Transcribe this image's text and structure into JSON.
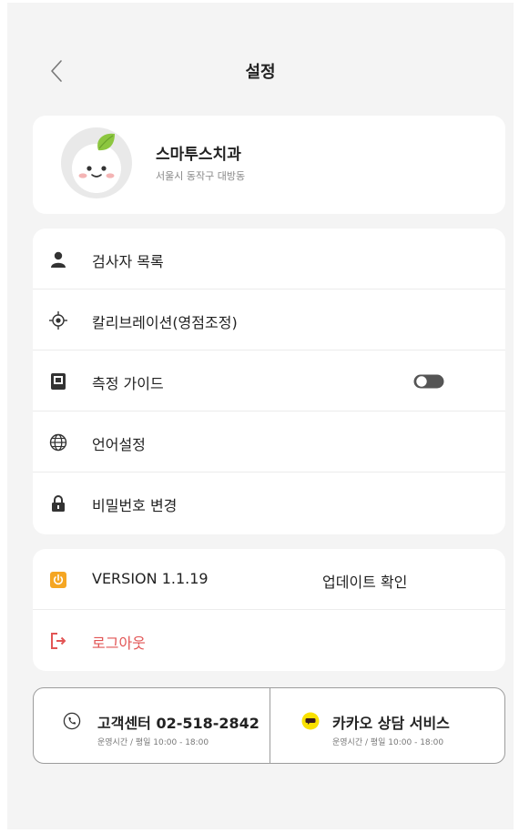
{
  "header": {
    "title": "설정",
    "back_icon": "chevron-left-icon"
  },
  "profile": {
    "name": "스마투스치과",
    "address": "서울시 동작구 대방동",
    "avatar": "mascot-avatar"
  },
  "menu": {
    "items": [
      {
        "label": "검사자 목록",
        "icon": "person-icon"
      },
      {
        "label": "칼리브레이션(영점조정)",
        "icon": "crosshair-icon"
      },
      {
        "label": "측정 가이드",
        "icon": "guide-book-icon",
        "toggle": false
      },
      {
        "label": "언어설정",
        "icon": "globe-icon"
      },
      {
        "label": "비밀번호 변경",
        "icon": "lock-icon"
      }
    ]
  },
  "version": {
    "label": "VERSION 1.1.19",
    "update_label": "업데이트 확인",
    "icon": "power-icon",
    "accent_color": "#f5a623"
  },
  "logout": {
    "label": "로그아웃",
    "icon": "logout-icon",
    "color": "#e25555"
  },
  "contact": {
    "phone_title": "고객센터 02-518-2842",
    "phone_hours": "운영시간 / 평일 10:00 - 18:00",
    "kakao_title": "카카오 상담 서비스",
    "kakao_hours": "운영시간 / 평일 10:00 - 18:00",
    "kakao_color": "#fae100"
  }
}
